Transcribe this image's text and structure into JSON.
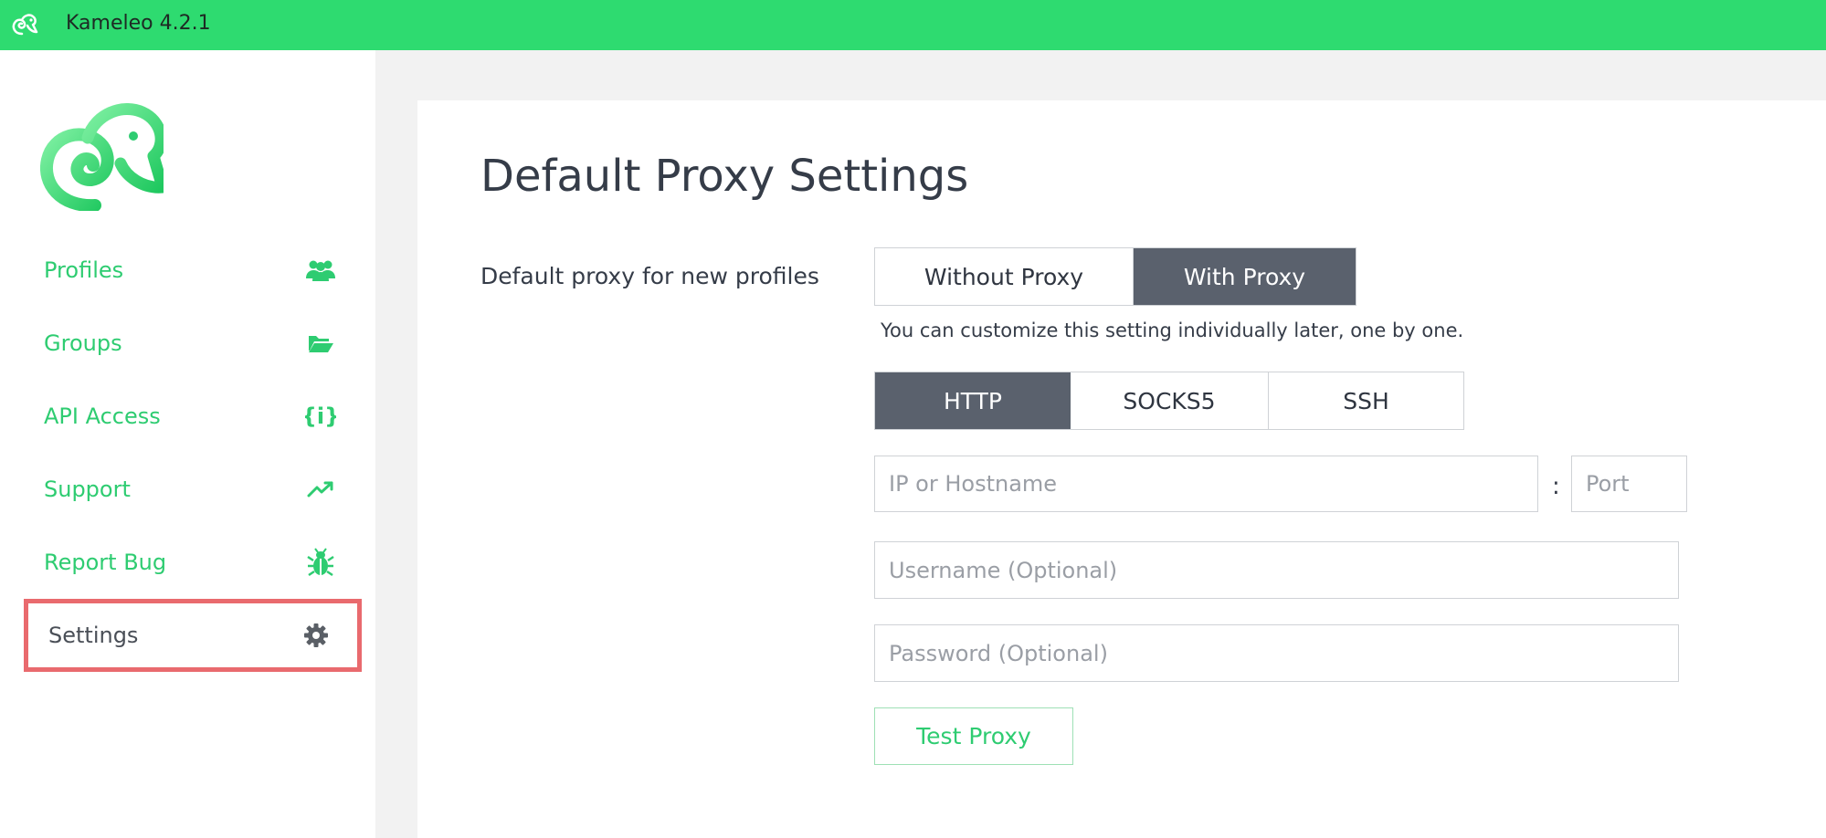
{
  "app": {
    "title": "Kameleo 4.2.1"
  },
  "sidebar": {
    "items": [
      {
        "label": "Profiles",
        "icon": "users-icon"
      },
      {
        "label": "Groups",
        "icon": "folder-open-icon"
      },
      {
        "label": "API Access",
        "icon": "code-braces-icon"
      },
      {
        "label": "Support",
        "icon": "trending-up-icon"
      },
      {
        "label": "Report Bug",
        "icon": "bug-icon"
      },
      {
        "label": "Settings",
        "icon": "gear-icon",
        "active": true
      }
    ]
  },
  "main": {
    "title": "Default Proxy Settings",
    "proxy_field_label": "Default proxy for new profiles",
    "proxy_mode": {
      "options": [
        "Without Proxy",
        "With Proxy"
      ],
      "selected": "With Proxy"
    },
    "hint": "You can customize this setting individually later, one by one.",
    "protocol": {
      "options": [
        "HTTP",
        "SOCKS5",
        "SSH"
      ],
      "selected": "HTTP"
    },
    "host_placeholder": "IP or Hostname",
    "port_placeholder": "Port",
    "colon": ":",
    "username_placeholder": "Username (Optional)",
    "password_placeholder": "Password (Optional)",
    "test_button": "Test Proxy"
  },
  "colors": {
    "brand_green": "#2edb70",
    "nav_green": "#2ecc71",
    "selected_segment": "#5a616d",
    "highlight_border": "#e96a6e"
  }
}
